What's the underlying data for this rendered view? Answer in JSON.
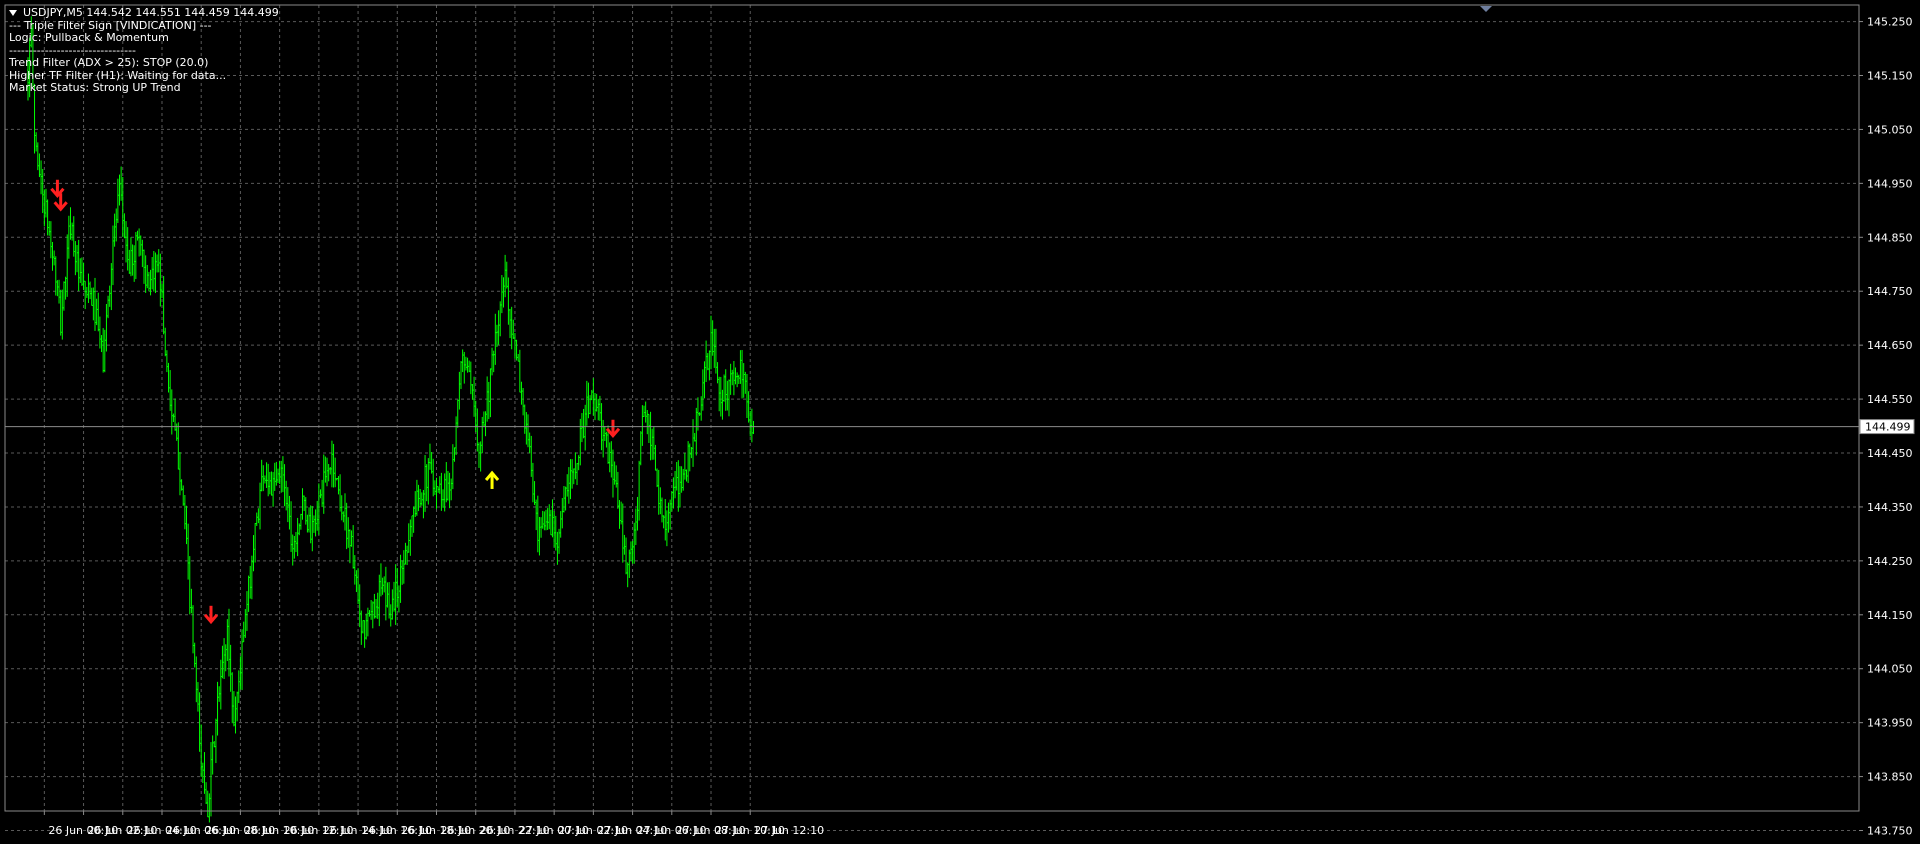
{
  "header": {
    "symbol_line": "USDJPY,M5  144.542 144.551 144.459 144.499",
    "indicator_title": "--- Triple Filter Sign [VINDICATION] ---",
    "logic_line": "Logic: Pullback & Momentum",
    "separator_line": "--------------------------------",
    "trend_filter": "Trend Filter (ADX > 25): STOP (20.0)",
    "higher_tf_filter": "Higher TF Filter (H1): Waiting for data...",
    "market_status": "Market Status: Strong UP Trend"
  },
  "current_price": "144.499",
  "colors": {
    "background": "#000000",
    "grid": "#5a5a5a",
    "candle": "#00ff00",
    "sell_arrow": "#ff2020",
    "buy_arrow": "#ffff00",
    "axis_text": "#ffffff",
    "price_line": "#8c8c8c"
  },
  "chart_data": {
    "type": "candlestick",
    "symbol": "USDJPY",
    "timeframe": "M5",
    "y_ticks": [
      "145.250",
      "145.150",
      "145.050",
      "144.950",
      "144.850",
      "144.750",
      "144.650",
      "144.550",
      "144.450",
      "144.350",
      "144.250",
      "144.150",
      "144.050",
      "143.950",
      "143.850",
      "143.750"
    ],
    "x_ticks": [
      "25 Jun 2025",
      "26 Jun 00:10",
      "26 Jun 02:10",
      "26 Jun 04:10",
      "26 Jun 06:10",
      "26 Jun 08:10",
      "26 Jun 10:10",
      "26 Jun 12:10",
      "26 Jun 14:10",
      "26 Jun 16:10",
      "26 Jun 18:10",
      "26 Jun 20:10",
      "26 Jun 22:10",
      "27 Jun 00:10",
      "27 Jun 02:10",
      "27 Jun 04:10",
      "27 Jun 06:10",
      "27 Jun 08:10",
      "27 Jun 10:10",
      "27 Jun 12:10"
    ],
    "ylim": [
      143.725,
      145.29
    ],
    "grid": true,
    "price_path": [
      {
        "t": "25 Jun 23:20",
        "p": 145.16
      },
      {
        "t": "25 Jun 23:30",
        "p": 145.22
      },
      {
        "t": "25 Jun 23:40",
        "p": 145.04
      },
      {
        "t": "26 Jun 00:00",
        "p": 144.95
      },
      {
        "t": "26 Jun 00:40",
        "p": 144.8
      },
      {
        "t": "26 Jun 01:00",
        "p": 144.69
      },
      {
        "t": "26 Jun 01:30",
        "p": 144.88
      },
      {
        "t": "26 Jun 02:00",
        "p": 144.76
      },
      {
        "t": "26 Jun 02:40",
        "p": 144.73
      },
      {
        "t": "26 Jun 03:10",
        "p": 144.62
      },
      {
        "t": "26 Jun 03:40",
        "p": 144.84
      },
      {
        "t": "26 Jun 04:00",
        "p": 144.93
      },
      {
        "t": "26 Jun 04:30",
        "p": 144.79
      },
      {
        "t": "26 Jun 05:00",
        "p": 144.86
      },
      {
        "t": "26 Jun 05:30",
        "p": 144.74
      },
      {
        "t": "26 Jun 06:00",
        "p": 144.82
      },
      {
        "t": "26 Jun 06:20",
        "p": 144.64
      },
      {
        "t": "26 Jun 06:40",
        "p": 144.52
      },
      {
        "t": "26 Jun 07:10",
        "p": 144.4
      },
      {
        "t": "26 Jun 07:40",
        "p": 144.14
      },
      {
        "t": "26 Jun 08:10",
        "p": 143.87
      },
      {
        "t": "26 Jun 08:30",
        "p": 143.8
      },
      {
        "t": "26 Jun 09:00",
        "p": 143.98
      },
      {
        "t": "26 Jun 09:30",
        "p": 144.12
      },
      {
        "t": "26 Jun 09:50",
        "p": 143.95
      },
      {
        "t": "26 Jun 10:20",
        "p": 144.11
      },
      {
        "t": "26 Jun 10:50",
        "p": 144.28
      },
      {
        "t": "26 Jun 11:20",
        "p": 144.42
      },
      {
        "t": "26 Jun 11:50",
        "p": 144.38
      },
      {
        "t": "26 Jun 12:20",
        "p": 144.42
      },
      {
        "t": "26 Jun 12:50",
        "p": 144.28
      },
      {
        "t": "26 Jun 13:20",
        "p": 144.35
      },
      {
        "t": "26 Jun 13:50",
        "p": 144.3
      },
      {
        "t": "26 Jun 14:20",
        "p": 144.38
      },
      {
        "t": "26 Jun 14:50",
        "p": 144.44
      },
      {
        "t": "26 Jun 15:20",
        "p": 144.35
      },
      {
        "t": "26 Jun 15:50",
        "p": 144.28
      },
      {
        "t": "26 Jun 16:20",
        "p": 144.11
      },
      {
        "t": "26 Jun 16:50",
        "p": 144.15
      },
      {
        "t": "26 Jun 17:20",
        "p": 144.2
      },
      {
        "t": "26 Jun 17:50",
        "p": 144.16
      },
      {
        "t": "26 Jun 18:20",
        "p": 144.22
      },
      {
        "t": "26 Jun 18:50",
        "p": 144.32
      },
      {
        "t": "26 Jun 19:20",
        "p": 144.38
      },
      {
        "t": "26 Jun 19:50",
        "p": 144.42
      },
      {
        "t": "26 Jun 20:20",
        "p": 144.38
      },
      {
        "t": "26 Jun 20:50",
        "p": 144.39
      },
      {
        "t": "26 Jun 21:10",
        "p": 144.49
      },
      {
        "t": "26 Jun 21:30",
        "p": 144.64
      },
      {
        "t": "26 Jun 21:50",
        "p": 144.58
      },
      {
        "t": "26 Jun 22:20",
        "p": 144.47
      },
      {
        "t": "26 Jun 22:40",
        "p": 144.53
      },
      {
        "t": "26 Jun 23:10",
        "p": 144.65
      },
      {
        "t": "26 Jun 23:40",
        "p": 144.78
      },
      {
        "t": "27 Jun 00:10",
        "p": 144.64
      },
      {
        "t": "27 Jun 00:30",
        "p": 144.56
      },
      {
        "t": "27 Jun 01:00",
        "p": 144.42
      },
      {
        "t": "27 Jun 01:20",
        "p": 144.28
      },
      {
        "t": "27 Jun 01:50",
        "p": 144.33
      },
      {
        "t": "27 Jun 02:20",
        "p": 144.3
      },
      {
        "t": "27 Jun 02:50",
        "p": 144.38
      },
      {
        "t": "27 Jun 03:20",
        "p": 144.45
      },
      {
        "t": "27 Jun 03:50",
        "p": 144.53
      },
      {
        "t": "27 Jun 04:10",
        "p": 144.56
      },
      {
        "t": "27 Jun 04:40",
        "p": 144.48
      },
      {
        "t": "27 Jun 05:10",
        "p": 144.42
      },
      {
        "t": "27 Jun 05:30",
        "p": 144.33
      },
      {
        "t": "27 Jun 05:50",
        "p": 144.23
      },
      {
        "t": "27 Jun 06:20",
        "p": 144.3
      },
      {
        "t": "27 Jun 06:40",
        "p": 144.54
      },
      {
        "t": "27 Jun 07:10",
        "p": 144.46
      },
      {
        "t": "27 Jun 07:40",
        "p": 144.32
      },
      {
        "t": "27 Jun 08:10",
        "p": 144.36
      },
      {
        "t": "27 Jun 08:40",
        "p": 144.4
      },
      {
        "t": "27 Jun 09:10",
        "p": 144.46
      },
      {
        "t": "27 Jun 09:40",
        "p": 144.55
      },
      {
        "t": "27 Jun 10:10",
        "p": 144.66
      },
      {
        "t": "27 Jun 10:40",
        "p": 144.56
      },
      {
        "t": "27 Jun 11:10",
        "p": 144.58
      },
      {
        "t": "27 Jun 11:40",
        "p": 144.6
      },
      {
        "t": "27 Jun 12:10",
        "p": 144.52
      },
      {
        "t": "27 Jun 12:20",
        "p": 144.499
      }
    ],
    "signals": [
      {
        "type": "sell",
        "t": "26 Jun 00:50",
        "p": 144.94
      },
      {
        "type": "sell",
        "t": "26 Jun 01:00",
        "p": 144.915
      },
      {
        "type": "sell",
        "t": "26 Jun 08:40",
        "p": 144.15
      },
      {
        "type": "buy",
        "t": "26 Jun 23:00",
        "p": 144.4
      },
      {
        "type": "sell",
        "t": "27 Jun 05:10",
        "p": 144.495
      }
    ]
  }
}
